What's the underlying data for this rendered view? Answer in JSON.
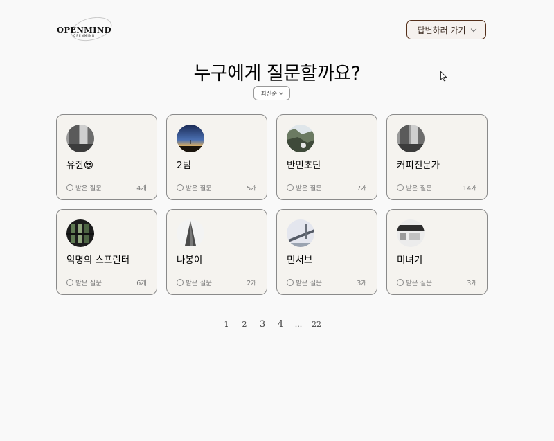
{
  "header": {
    "logo_text": "OPENMIND",
    "logo_sub": "OPENMIND",
    "answer_button": "답변하러 가기"
  },
  "main": {
    "title": "누구에게 질문할까요?",
    "sort_label": "최신순"
  },
  "cards": [
    {
      "name": "유쥔😎",
      "question_label": "받은 질문",
      "count": "4개",
      "avatar": "building-photo"
    },
    {
      "name": "2팀",
      "question_label": "받은 질문",
      "count": "5개",
      "avatar": "sunset-photo"
    },
    {
      "name": "반민초단",
      "question_label": "받은 질문",
      "count": "7개",
      "avatar": "cliff-photo"
    },
    {
      "name": "커피전문가",
      "question_label": "받은 질문",
      "count": "14개",
      "avatar": "building-photo"
    },
    {
      "name": "익명의 스프린터",
      "question_label": "받은 질문",
      "count": "6개",
      "avatar": "window-photo"
    },
    {
      "name": "나봉이",
      "question_label": "받은 질문",
      "count": "2개",
      "avatar": "tower-photo"
    },
    {
      "name": "민서브",
      "question_label": "받은 질문",
      "count": "3개",
      "avatar": "bridge-photo"
    },
    {
      "name": "미녀기",
      "question_label": "받은 질문",
      "count": "3개",
      "avatar": "interior-photo"
    }
  ],
  "pagination": [
    "1",
    "2",
    "3",
    "4",
    "...",
    "22"
  ]
}
